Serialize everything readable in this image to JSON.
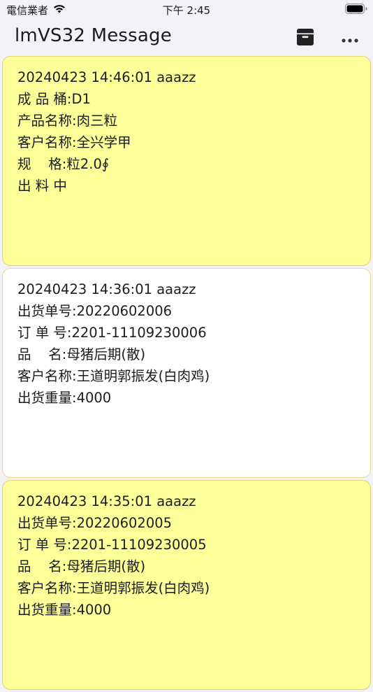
{
  "status_bar": {
    "carrier": "電信業者",
    "time": "下午 2:45"
  },
  "app_bar": {
    "title": "lmVS32 Message",
    "actions": [
      "archive-icon",
      "more-horizontal-icon"
    ]
  },
  "colors": {
    "card_yellow": "#ffff99",
    "card_white": "#ffffff",
    "card_border": "#e8d07a"
  },
  "messages": [
    {
      "color": "yellow",
      "lines": [
        "20240423 14:46:01 aaazz",
        "成 品 桶:D1",
        "产品名称:肉三粒",
        "客户名称:全兴学甲",
        "规    格:粒2.0∮",
        "出 料 中"
      ]
    },
    {
      "color": "white",
      "lines": [
        "20240423 14:36:01 aaazz",
        "出货单号:20220602006",
        "订 单 号:2201-11109230006",
        "品    名:母猪后期(散)",
        "客户名称:王道明郭振发(白肉鸡)",
        "出货重量:4000"
      ]
    },
    {
      "color": "yellow",
      "lines": [
        "20240423 14:35:01 aaazz",
        "出货单号:20220602005",
        "订 单 号:2201-11109230005",
        "品    名:母猪后期(散)",
        "客户名称:王道明郭振发(白肉鸡)",
        "出货重量:4000"
      ]
    }
  ]
}
